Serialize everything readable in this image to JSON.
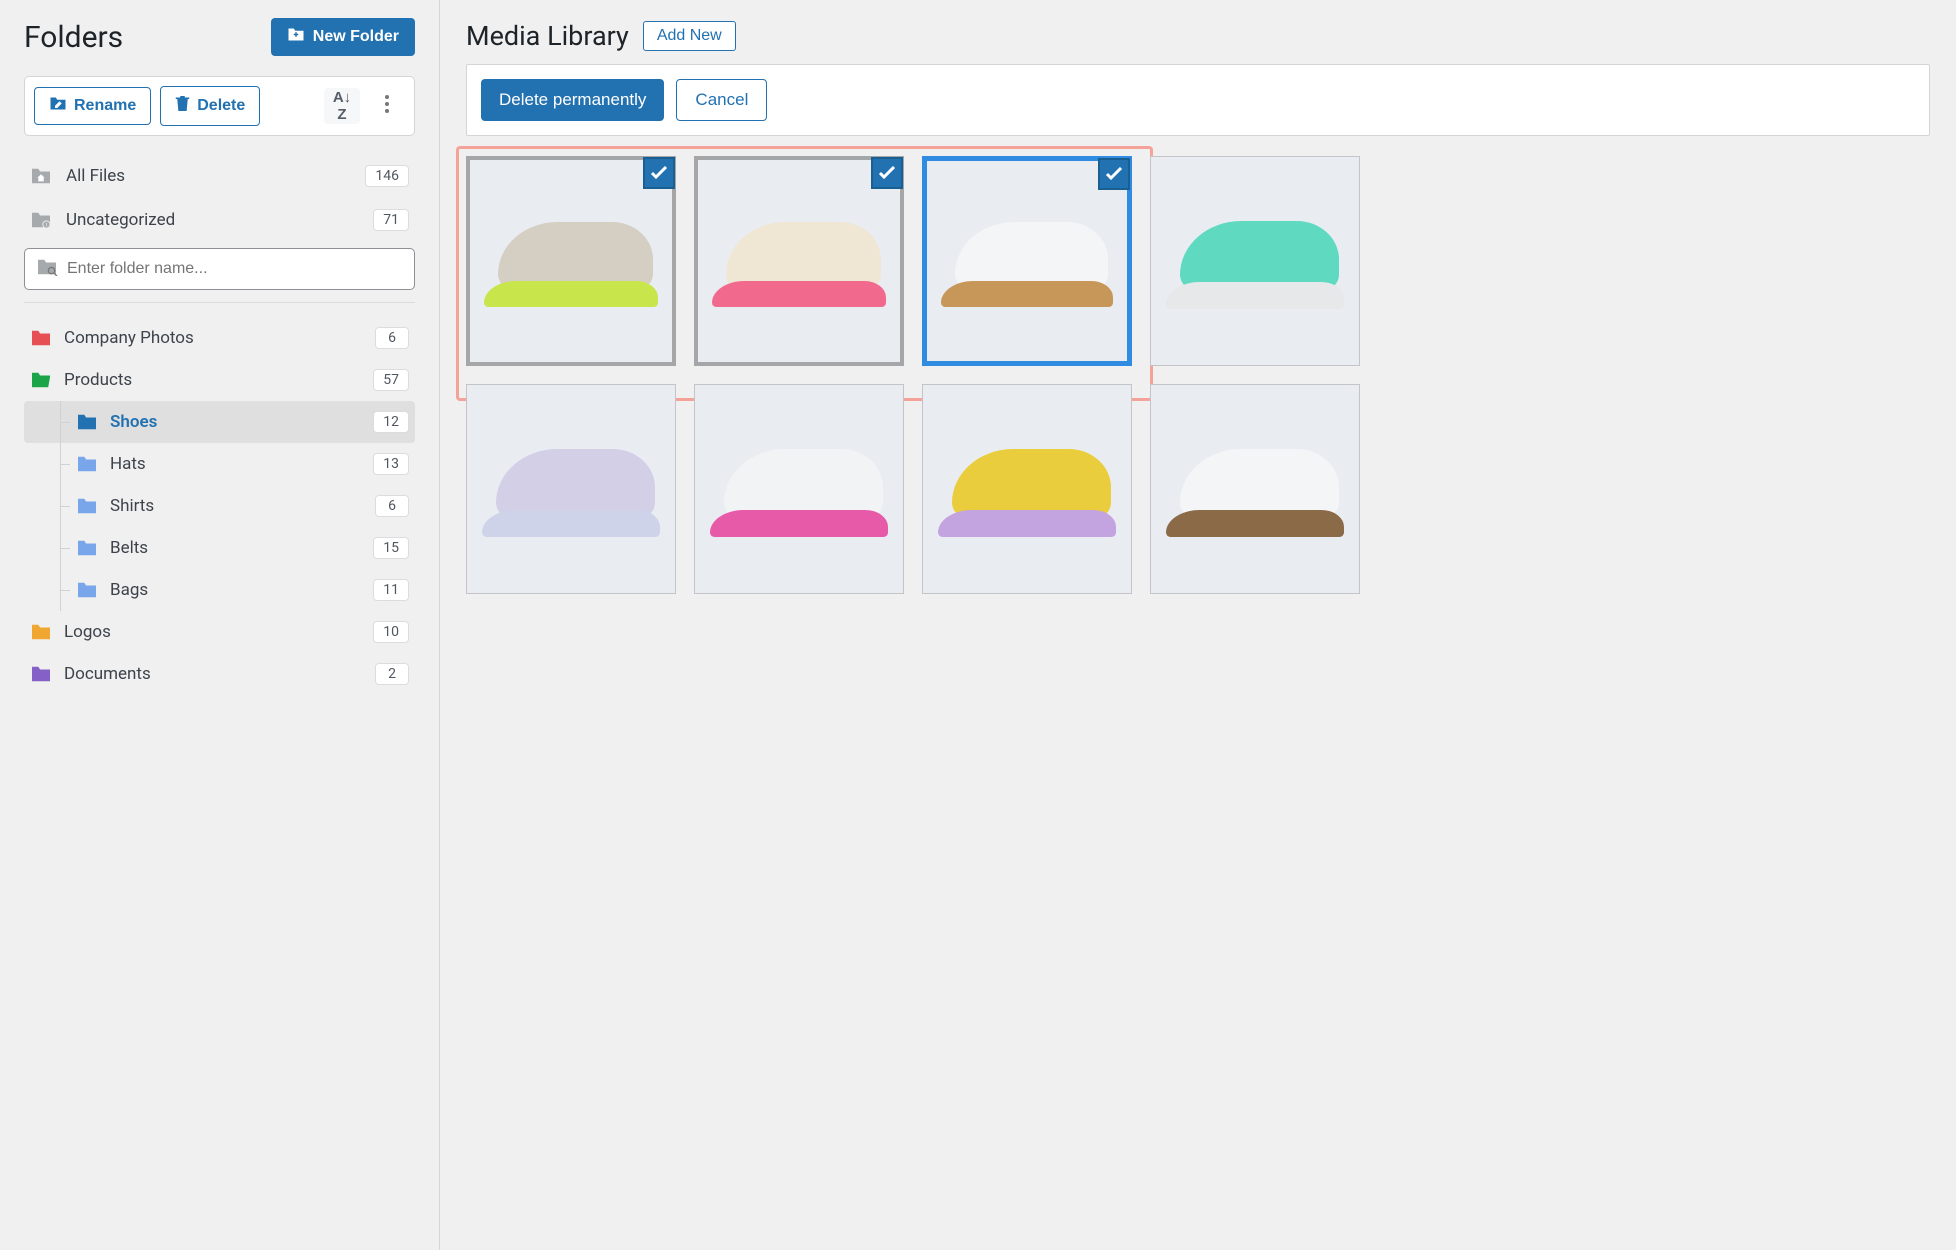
{
  "sidebar": {
    "title": "Folders",
    "newFolderLabel": "New Folder",
    "renameLabel": "Rename",
    "deleteLabel": "Delete",
    "allFilesLabel": "All Files",
    "allFilesCount": "146",
    "uncategorizedLabel": "Uncategorized",
    "uncategorizedCount": "71",
    "searchPlaceholder": "Enter folder name...",
    "tree": [
      {
        "label": "Company Photos",
        "count": "6",
        "color": "#e65054"
      },
      {
        "label": "Products",
        "count": "57",
        "color": "#1ba548",
        "open": true,
        "children": [
          {
            "label": "Shoes",
            "count": "12",
            "color": "#2271b1",
            "active": true
          },
          {
            "label": "Hats",
            "count": "13",
            "color": "#79a6ea"
          },
          {
            "label": "Shirts",
            "count": "6",
            "color": "#79a6ea"
          },
          {
            "label": "Belts",
            "count": "15",
            "color": "#79a6ea"
          },
          {
            "label": "Bags",
            "count": "11",
            "color": "#79a6ea"
          }
        ]
      },
      {
        "label": "Logos",
        "count": "10",
        "color": "#f0a731"
      },
      {
        "label": "Documents",
        "count": "2",
        "color": "#8460c7"
      }
    ]
  },
  "main": {
    "title": "Media Library",
    "addNewLabel": "Add New",
    "deletePermLabel": "Delete permanently",
    "cancelLabel": "Cancel"
  },
  "thumbs": [
    {
      "checked": true,
      "highlight": false,
      "upper": "#d4cec3",
      "sole": "#c8e64b"
    },
    {
      "checked": true,
      "highlight": false,
      "upper": "#efe6d4",
      "sole": "#f16a8e"
    },
    {
      "checked": true,
      "highlight": true,
      "upper": "#f4f5f6",
      "sole": "#c7975a"
    },
    {
      "checked": false,
      "highlight": false,
      "upper": "#5fd9bf",
      "sole": "#e6e8ea"
    },
    {
      "checked": false,
      "highlight": false,
      "upper": "#d3cfe7",
      "sole": "#cfd3ea"
    },
    {
      "checked": false,
      "highlight": false,
      "upper": "#f2f3f5",
      "sole": "#e65aa7"
    },
    {
      "checked": false,
      "highlight": false,
      "upper": "#eacd3c",
      "sole": "#c4a4e0"
    },
    {
      "checked": false,
      "highlight": false,
      "upper": "#f4f5f6",
      "sole": "#8a6a47"
    }
  ]
}
